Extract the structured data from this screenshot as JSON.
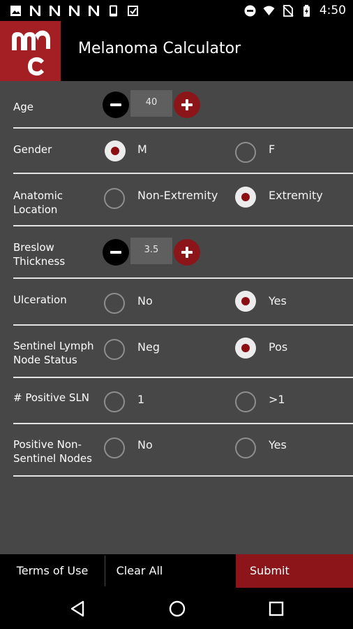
{
  "status_bar": {
    "time": "4:50",
    "left_icons": [
      "image-icon",
      "n-icon",
      "n-icon",
      "n-icon",
      "n-icon",
      "phone-icon",
      "check-clipboard-icon"
    ],
    "right_icons": [
      "do-not-disturb-icon",
      "wifi-icon",
      "no-sim-icon",
      "battery-icon"
    ]
  },
  "app_bar": {
    "title": "Melanoma Calculator",
    "logo": "mc-logo",
    "logo_color": "#a31f24"
  },
  "form": {
    "age": {
      "label": "Age",
      "value": "40"
    },
    "gender": {
      "label": "Gender",
      "options": [
        "M",
        "F"
      ],
      "selected": "M"
    },
    "location": {
      "label": "Anatomic Location",
      "options": [
        "Non-Extremity",
        "Extremity"
      ],
      "selected": "Extremity"
    },
    "breslow": {
      "label": "Breslow Thickness",
      "value": "3.5"
    },
    "ulceration": {
      "label": "Ulceration",
      "options": [
        "No",
        "Yes"
      ],
      "selected": "Yes"
    },
    "sentinel": {
      "label": "Sentinel Lymph Node Status",
      "options": [
        "Neg",
        "Pos"
      ],
      "selected": "Pos"
    },
    "positive_sln": {
      "label": "# Positive SLN",
      "options": [
        "1",
        ">1"
      ],
      "selected": null
    },
    "non_sentinel": {
      "label": "Positive Non-Sentinel Nodes",
      "options": [
        "No",
        "Yes"
      ],
      "selected": null
    }
  },
  "bottom_bar": {
    "terms": "Terms of Use",
    "clear": "Clear All",
    "submit": "Submit"
  },
  "colors": {
    "accent": "#8b1519",
    "background": "#474747",
    "bar": "#000000"
  }
}
